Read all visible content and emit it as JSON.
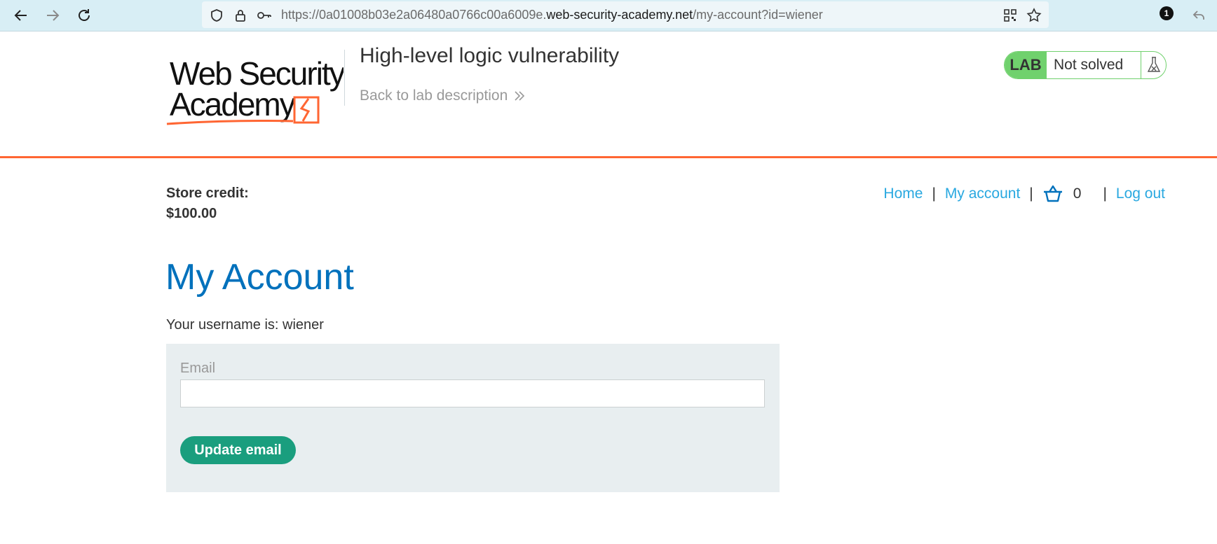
{
  "browser": {
    "url_prefix": "https://0a01008b03e2a06480a0766c00a6009e.",
    "url_host": "web-security-academy.net",
    "url_path": "/my-account?id=wiener",
    "notification_count": "1"
  },
  "lab": {
    "logo_line1": "Web Security",
    "logo_line2": "Academy",
    "title": "High-level logic vulnerability",
    "back_link": "Back to lab description",
    "status_tag": "LAB",
    "status_text": "Not solved",
    "status_color": "#70d16d",
    "accent_color": "#ff6633"
  },
  "nav": {
    "home": "Home",
    "my_account": "My account",
    "cart_count": "0",
    "logout": "Log out",
    "separator": "|",
    "link_color": "#29a8e0"
  },
  "store": {
    "credit_label": "Store credit:",
    "credit_value": "$100.00"
  },
  "main": {
    "title": "My Account",
    "username_line": "Your username is: wiener",
    "email_label": "Email",
    "email_value": "",
    "update_button": "Update email",
    "button_color": "#1a9e7e"
  }
}
